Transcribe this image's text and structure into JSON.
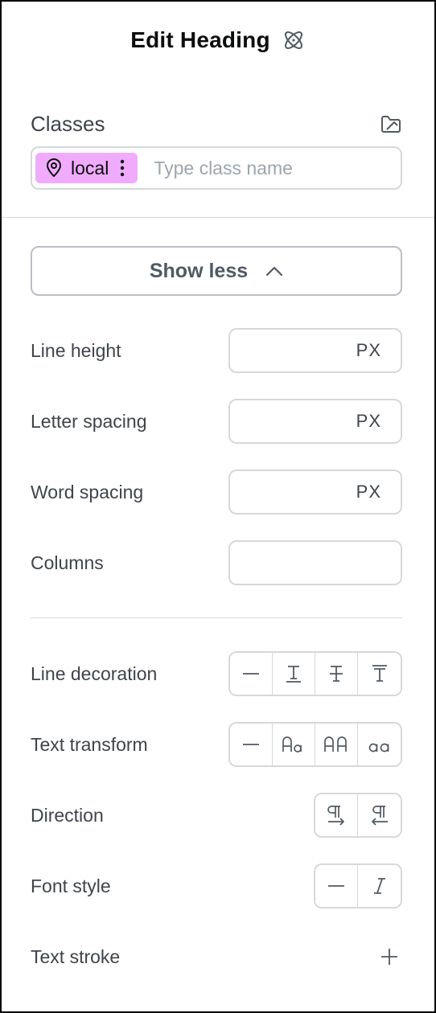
{
  "header": {
    "title": "Edit Heading",
    "icon": "atom-icon"
  },
  "classes": {
    "label": "Classes",
    "manager_icon": "class-manager-icon",
    "chip": {
      "label": "local",
      "icon": "location-pin-icon",
      "color": "#f0abfc"
    },
    "input_placeholder": "Type class name",
    "input_value": ""
  },
  "show_less": {
    "label": "Show less",
    "icon": "chevron-up-icon"
  },
  "fields": {
    "line_height": {
      "label": "Line height",
      "unit": "PX",
      "value": ""
    },
    "letter_spacing": {
      "label": "Letter spacing",
      "unit": "PX",
      "value": ""
    },
    "word_spacing": {
      "label": "Word spacing",
      "unit": "PX",
      "value": ""
    },
    "columns": {
      "label": "Columns",
      "value": ""
    }
  },
  "line_decoration": {
    "label": "Line decoration",
    "options": [
      "none-icon",
      "underline-icon",
      "strikethrough-icon",
      "overline-icon"
    ]
  },
  "text_transform": {
    "label": "Text transform",
    "options": [
      "none-icon",
      "capitalize-icon",
      "uppercase-icon",
      "lowercase-icon"
    ]
  },
  "direction": {
    "label": "Direction",
    "options": [
      "ltr-icon",
      "rtl-icon"
    ]
  },
  "font_style": {
    "label": "Font style",
    "options": [
      "none-icon",
      "italic-icon"
    ]
  },
  "text_stroke": {
    "label": "Text stroke",
    "icon": "plus-icon"
  },
  "colors": {
    "accent_chip": "#f0abfc",
    "border": "#d5d8dc",
    "text": "#3f444b"
  }
}
